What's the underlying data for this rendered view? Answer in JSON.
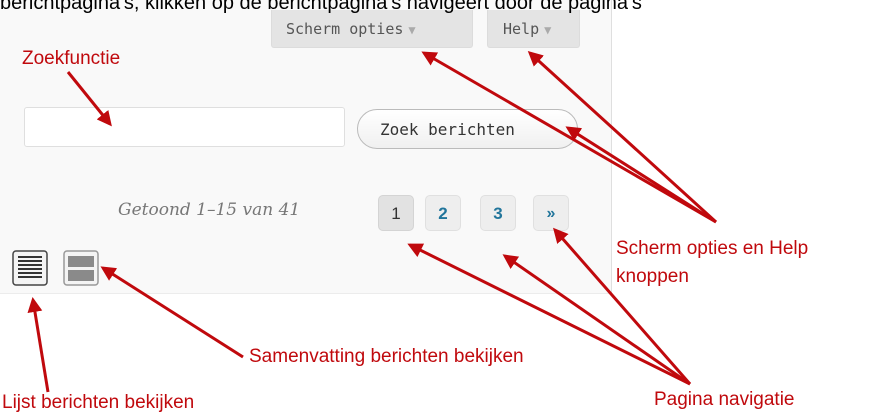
{
  "top_text": "berichtpagina's, klikken op de berichtpagina's navigeert door de pagina's",
  "toolbar": {
    "screen_options_label": "Scherm opties",
    "help_label": "Help",
    "dropdown_arrow": "▼"
  },
  "search": {
    "value": "",
    "placeholder": "",
    "button_label": "Zoek berichten"
  },
  "pagination": {
    "displaying": "Getoond 1–15 van 41",
    "pages": [
      "1",
      "2",
      "3"
    ],
    "current_page": "1",
    "next_label": "»"
  },
  "view_modes": [
    {
      "name": "list",
      "icon": "list-view-icon"
    },
    {
      "name": "excerpt",
      "icon": "excerpt-view-icon"
    }
  ],
  "annotations": {
    "zoekfunctie": "Zoekfunctie",
    "scherm_opties": "Scherm opties en Help knoppen",
    "samenvatting": "Samenvatting berichten bekijken",
    "lijst": "Lijst berichten bekijken",
    "pagina_navigatie": "Pagina navigatie"
  },
  "colors": {
    "annotation_red": "#c0090d",
    "link_blue": "#21759b",
    "panel_bg": "#f9f9f9"
  }
}
